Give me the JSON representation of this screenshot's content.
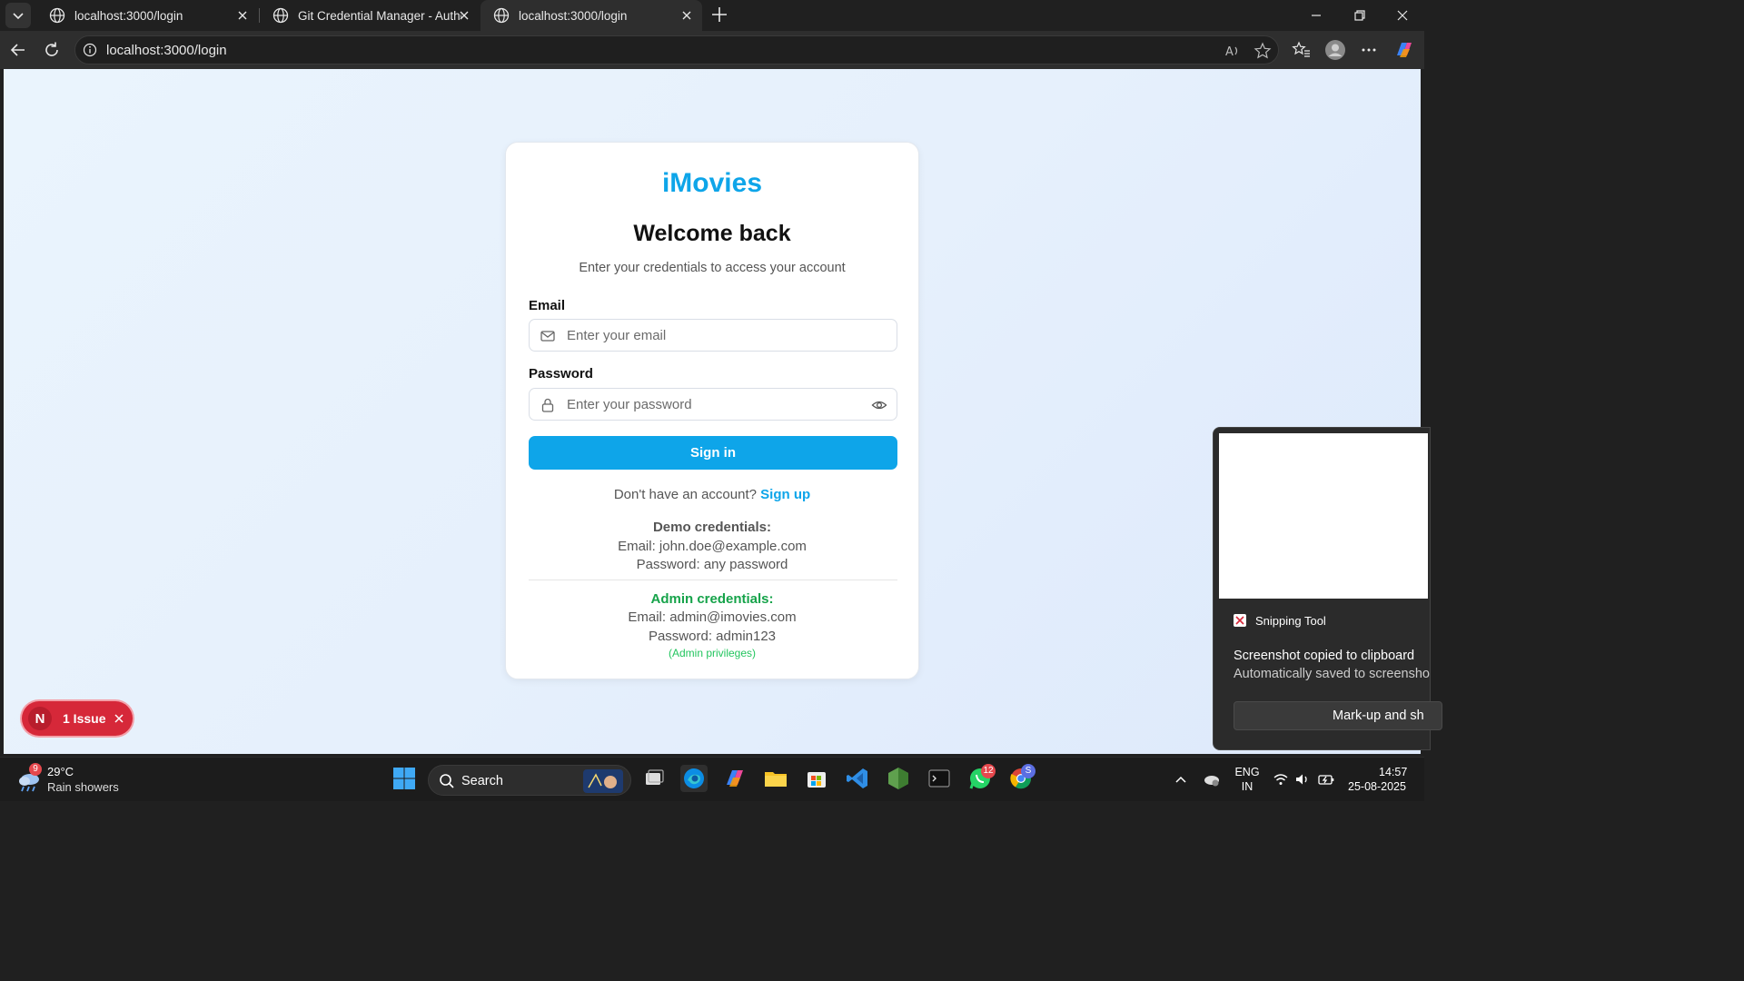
{
  "browser": {
    "tabs": [
      {
        "title": "localhost:3000/login",
        "active": false
      },
      {
        "title": "Git Credential Manager - Authent",
        "active": false
      },
      {
        "title": "localhost:3000/login",
        "active": true
      }
    ],
    "url": "localhost:3000/login"
  },
  "page": {
    "brand": "iMovies",
    "heading": "Welcome back",
    "subtitle": "Enter your credentials to access your account",
    "email_label": "Email",
    "email_placeholder": "Enter your email",
    "password_label": "Password",
    "password_placeholder": "Enter your password",
    "signin_label": "Sign in",
    "no_account_text": "Don't have an account?",
    "signup_label": "Sign up",
    "demo_title": "Demo credentials:",
    "demo_email": "Email: john.doe@example.com",
    "demo_password": "Password: any password",
    "admin_title": "Admin credentials:",
    "admin_email": "Email: admin@imovies.com",
    "admin_password": "Password: admin123",
    "admin_note": "(Admin privileges)",
    "accent_color": "#0ea5e9",
    "admin_color": "#16a34a"
  },
  "dev_overlay": {
    "badge_letter": "N",
    "issue_label": "1 Issue"
  },
  "notification": {
    "app_name": "Snipping Tool",
    "title": "Screenshot copied to clipboard",
    "subtitle": "Automatically saved to screensho",
    "button_label": "Mark-up and sh"
  },
  "taskbar": {
    "weather_badge": "9",
    "temperature": "29°C",
    "condition": "Rain showers",
    "search_label": "Search",
    "whatsapp_badge": "12",
    "chrome_badge": "S",
    "language": "ENG",
    "region": "IN",
    "time": "14:57",
    "date": "25-08-2025"
  }
}
